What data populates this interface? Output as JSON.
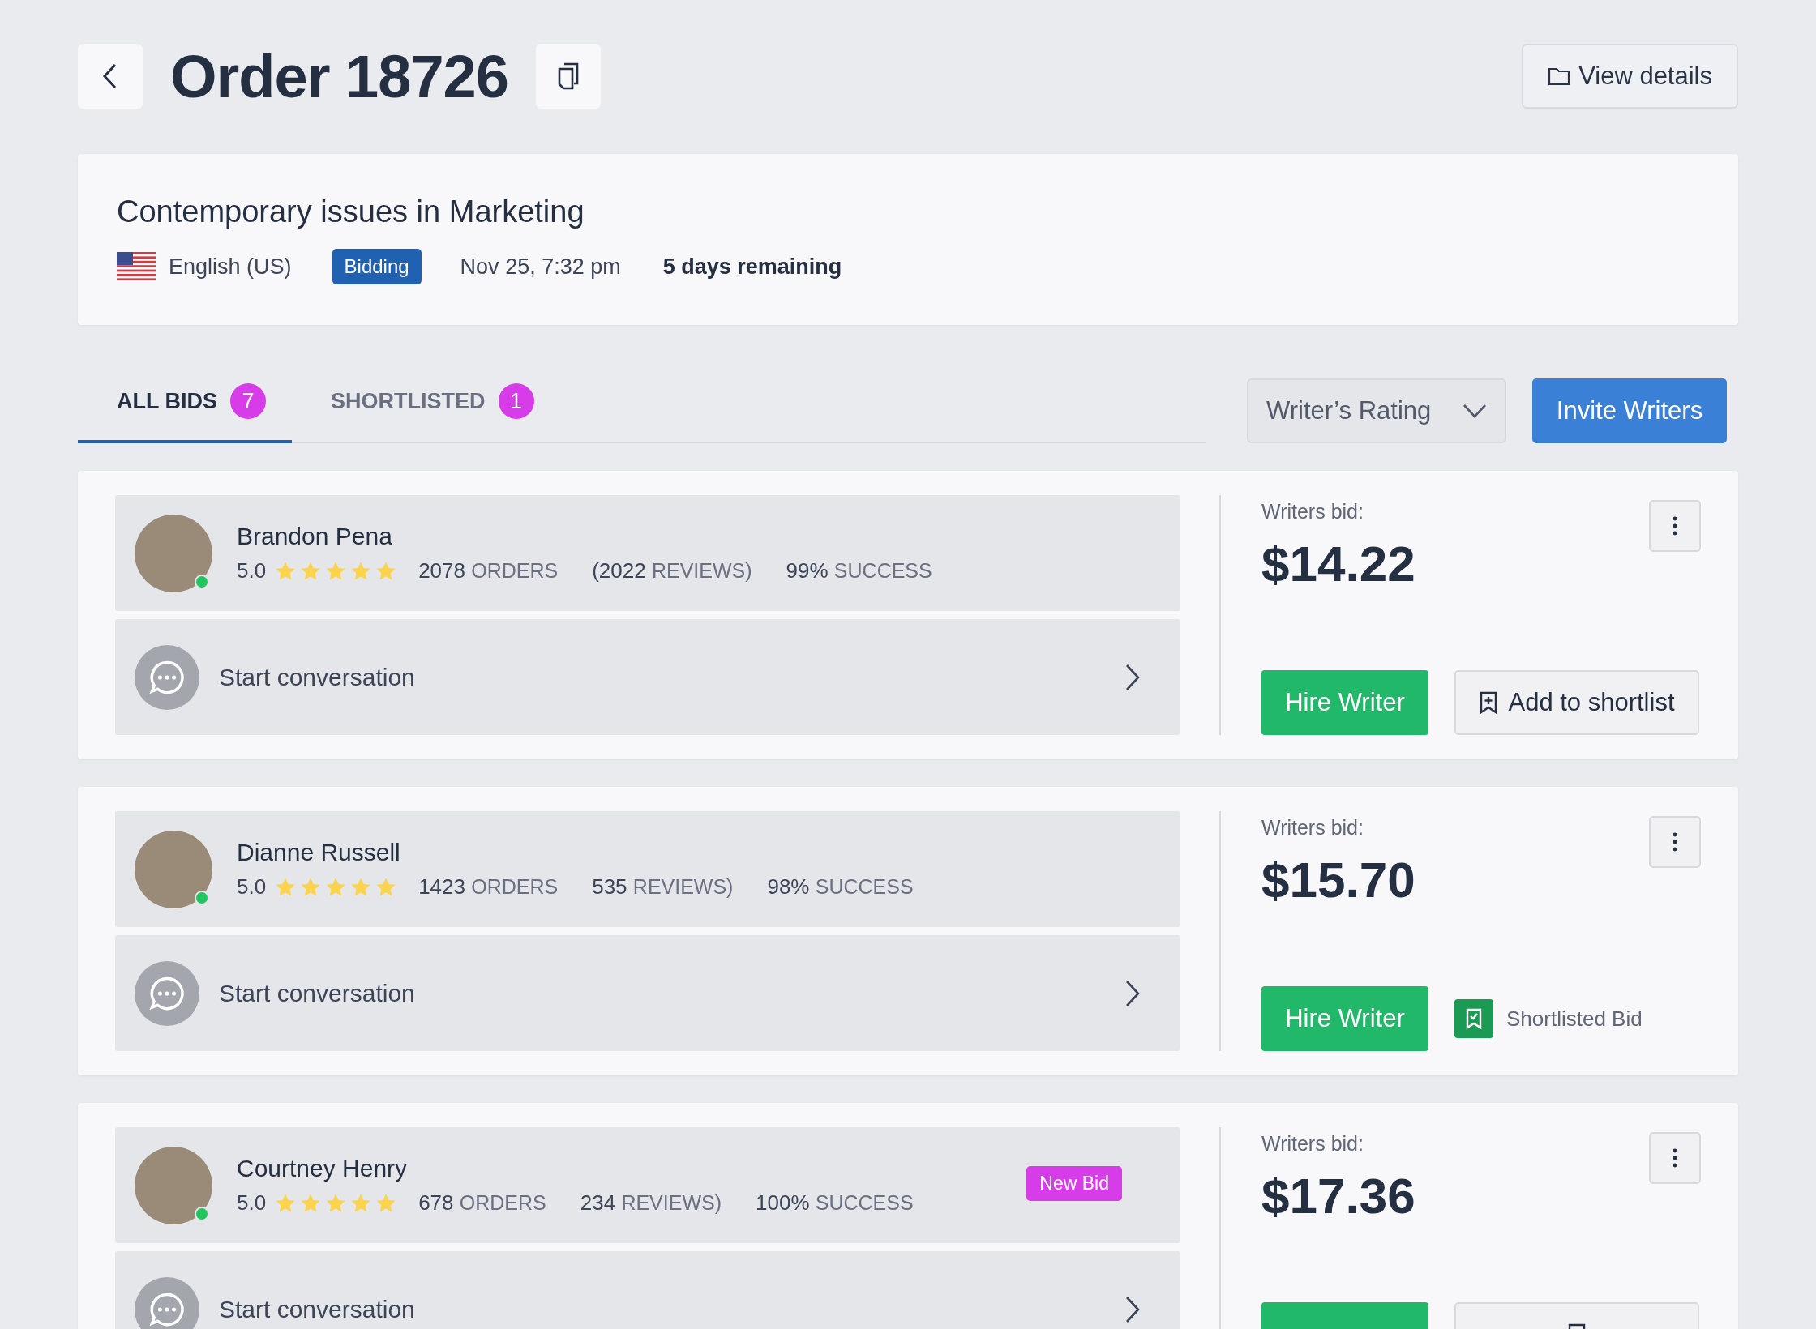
{
  "header": {
    "title": "Order 18726",
    "view_details": "View details"
  },
  "order": {
    "title": "Contemporary issues in Marketing",
    "language": "English (US)",
    "status": "Bidding",
    "date": "Nov 25, 7:32 pm",
    "remaining": "5 days remaining"
  },
  "tabs": [
    {
      "label": "ALL BIDS",
      "count": "7",
      "selected": true
    },
    {
      "label": "SHORTLISTED",
      "count": "1",
      "selected": false
    }
  ],
  "sort": {
    "value": "Writer’s Rating"
  },
  "invite_button": "Invite Writers",
  "bids": [
    {
      "name": "Brandon Pena",
      "online": true,
      "rating": "5.0",
      "stars": 5,
      "stats": [
        {
          "number": "2078",
          "unit": "ORDERS"
        },
        {
          "number": "(2022",
          "unit": "REVIEWS)"
        },
        {
          "number": "99%",
          "unit": "SUCCESS"
        }
      ],
      "conversation": "Start conversation",
      "bid_label": "Writers bid:",
      "price": "$14.22",
      "hire": "Hire Writer",
      "shortlist": {
        "kind": "add",
        "label": "Add to shortlist"
      }
    },
    {
      "name": "Dianne Russell",
      "online": true,
      "rating": "5.0",
      "stars": 5,
      "stats": [
        {
          "number": "1423",
          "unit": "ORDERS"
        },
        {
          "number": "535",
          "unit": "REVIEWS)"
        },
        {
          "number": "98%",
          "unit": "SUCCESS"
        }
      ],
      "conversation": "Start conversation",
      "bid_label": "Writers bid:",
      "price": "$15.70",
      "hire": "Hire Writer",
      "shortlist": {
        "kind": "shortlisted",
        "label": "Shortlisted Bid"
      }
    },
    {
      "name": "Courtney Henry",
      "online": true,
      "badge": "New Bid",
      "rating": "5.0",
      "stars": 5,
      "stats": [
        {
          "number": "678",
          "unit": "ORDERS"
        },
        {
          "number": "234",
          "unit": "REVIEWS)"
        },
        {
          "number": "100%",
          "unit": "SUCCESS"
        }
      ],
      "conversation": "Start conversation",
      "bid_label": "Writers bid:",
      "price": "$17.36",
      "shortlist": {
        "kind": "add"
      }
    }
  ]
}
